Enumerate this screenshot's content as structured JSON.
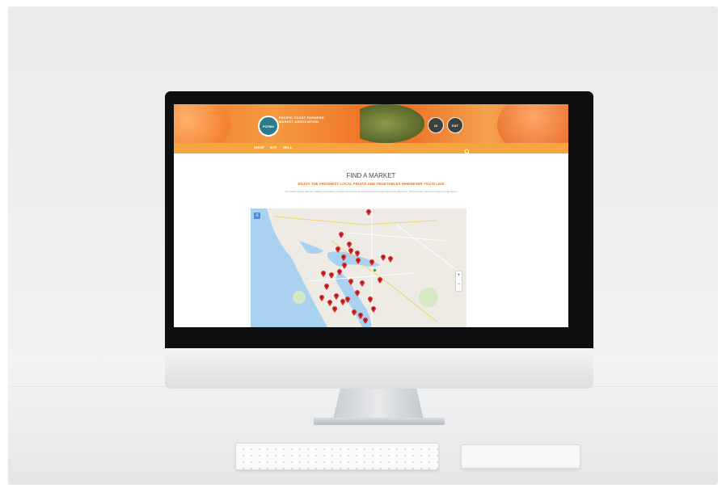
{
  "colors": {
    "brand_orange": "#f4a540",
    "hero_orange": "#f07a26",
    "subtitle_orange": "#e27a2c",
    "pin_red": "#d42a2a",
    "map_water": "#a8d2f0",
    "map_land": "#eeebe4"
  },
  "site": {
    "org_name": "PACIFIC COAST FARMERS' MARKET ASSOCIATION",
    "logo_text": "PCFMA",
    "badge_left": "10",
    "badge_right": "EAT"
  },
  "nav": {
    "items": [
      "SHOP",
      "EAT",
      "SELL"
    ],
    "search_icon": "search-icon"
  },
  "page": {
    "title": "FIND A MARKET",
    "subtitle": "ENJOY THE FRESHEST LOCAL FRUITS AND VEGETABLES WHEREVER YOU'D LIKE",
    "description": "The Pacific Coast Farmers' Market Association provides fresh produce from local farmers throughout the Bay Area. Find a market near you using the map below."
  },
  "map": {
    "layers_icon": "map-layers-icon",
    "zoom_in": "+",
    "zoom_out": "−"
  }
}
